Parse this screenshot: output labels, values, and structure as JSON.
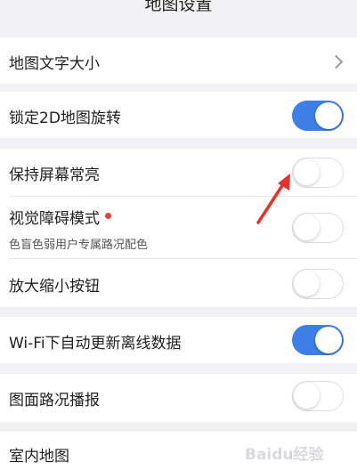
{
  "header": {
    "title": "地图设置"
  },
  "settings": {
    "text_size": {
      "label": "地图文字大小",
      "icon": "chevron-right-icon"
    },
    "lock_2d": {
      "label": "锁定2D地图旋转",
      "state": "on"
    },
    "screen_on": {
      "label": "保持屏幕常亮",
      "state": "off"
    },
    "visual_mode": {
      "label": "视觉障碍模式",
      "sublabel": "色盲色弱用户专属路况配色",
      "state": "off",
      "badge_color": "#e8413a"
    },
    "zoom_buttons": {
      "label": "放大缩小按钮",
      "state": "off"
    },
    "wifi_update": {
      "label": "Wi-Fi下自动更新离线数据",
      "state": "on"
    },
    "traffic_broadcast": {
      "label": "图面路况播报",
      "state": "off"
    },
    "indoor_map": {
      "label": "室内地图"
    }
  },
  "colors": {
    "accent": "#3d7ee8",
    "annotation_arrow": "#e8302a",
    "background": "#f2f2f4"
  },
  "watermark": {
    "text": "Baidu经验"
  }
}
